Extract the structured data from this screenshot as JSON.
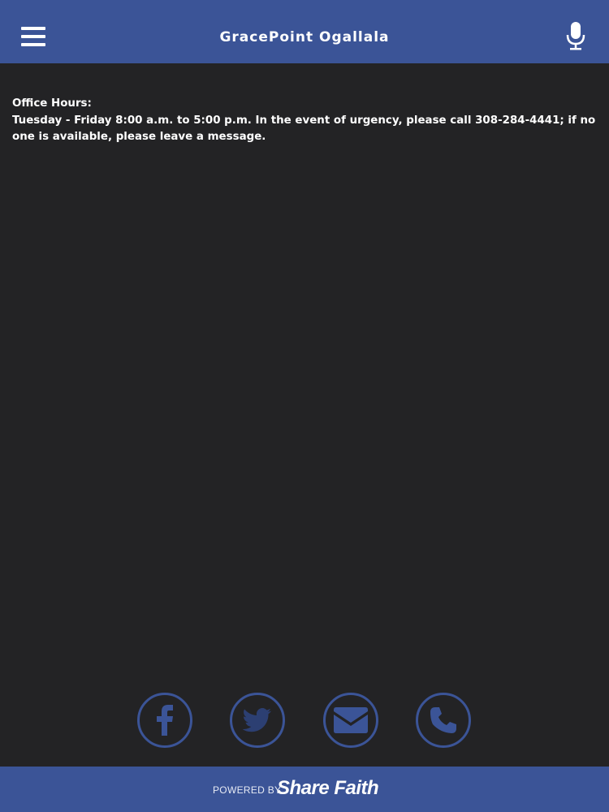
{
  "header": {
    "title": "GracePoint Ogallala",
    "menu_icon": "hamburger-menu-icon",
    "voice_icon": "microphone-icon"
  },
  "content": {
    "heading": "Office Hours:",
    "body": "Tuesday - Friday 8:00 a.m. to 5:00 p.m.  In the event of urgency, please call 308-284-4441; if no one is available, please leave a message."
  },
  "social": [
    {
      "name": "facebook",
      "icon": "facebook-icon"
    },
    {
      "name": "twitter",
      "icon": "twitter-icon"
    },
    {
      "name": "email",
      "icon": "envelope-icon"
    },
    {
      "name": "phone",
      "icon": "phone-icon"
    }
  ],
  "footer": {
    "powered_by": "POWERED BY",
    "brand": "Share Faith"
  },
  "colors": {
    "accent": "#3b5497",
    "background": "#232325",
    "text": "#ffffff"
  }
}
